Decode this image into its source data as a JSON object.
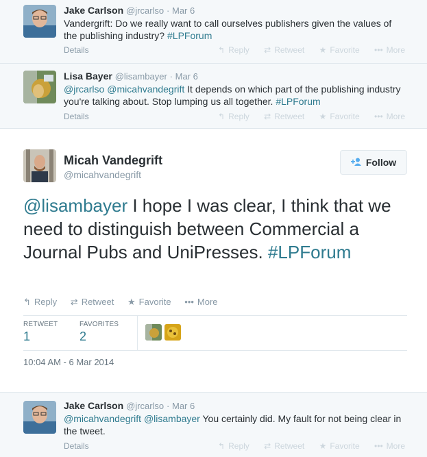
{
  "tweets_before": [
    {
      "name": "Jake Carlson",
      "handle": "@jrcarlso",
      "time": "· Mar 6",
      "text_parts": [
        {
          "kind": "text",
          "value": "Vandergrift: Do we really want to call ourselves publishers given the values of the publishing industry? "
        },
        {
          "kind": "hash",
          "value": "#LPForum"
        }
      ],
      "details": "Details"
    },
    {
      "name": "Lisa Bayer",
      "handle": "@lisambayer",
      "time": "· Mar 6",
      "text_parts": [
        {
          "kind": "mention",
          "value": "@jrcarlso"
        },
        {
          "kind": "text",
          "value": " "
        },
        {
          "kind": "mention",
          "value": "@micahvandegrift"
        },
        {
          "kind": "text",
          "value": " It depends on which part of the publishing industry you're talking about. Stop lumping us all together. "
        },
        {
          "kind": "hash",
          "value": "#LPForum"
        }
      ],
      "details": "Details"
    }
  ],
  "actions": {
    "reply": "Reply",
    "retweet": "Retweet",
    "favorite": "Favorite",
    "more": "More"
  },
  "main_tweet": {
    "name": "Micah Vandegrift",
    "handle": "@micahvandegrift",
    "follow_label": "Follow",
    "mention": "@lisambayer",
    "text": " I hope I was clear, I think that we need to distinguish between Commercial a Journal Pubs and UniPresses. ",
    "hashtag": "#LPForum",
    "stats": {
      "retweet_label": "RETWEET",
      "retweet_count": "1",
      "favorites_label": "FAVORITES",
      "favorites_count": "2"
    },
    "timestamp": "10:04 AM - 6 Mar 2014"
  },
  "tweets_after": [
    {
      "name": "Jake Carlson",
      "handle": "@jrcarlso",
      "time": "· Mar 6",
      "mention1": "@micahvandegrift",
      "mention2": "@lisambayer",
      "text": " You certainly did. My fault for not being clear in the tweet.",
      "details": "Details"
    }
  ],
  "icons": {
    "reply": "reply-icon",
    "retweet": "retweet-icon",
    "favorite": "star-icon",
    "more": "more-dots-icon",
    "follow": "add-user-icon"
  },
  "colors": {
    "hashtag": "#2f7b8f",
    "muted": "#8899a6",
    "background_context": "#f5f8fa",
    "follow_icon": "#55acee"
  }
}
